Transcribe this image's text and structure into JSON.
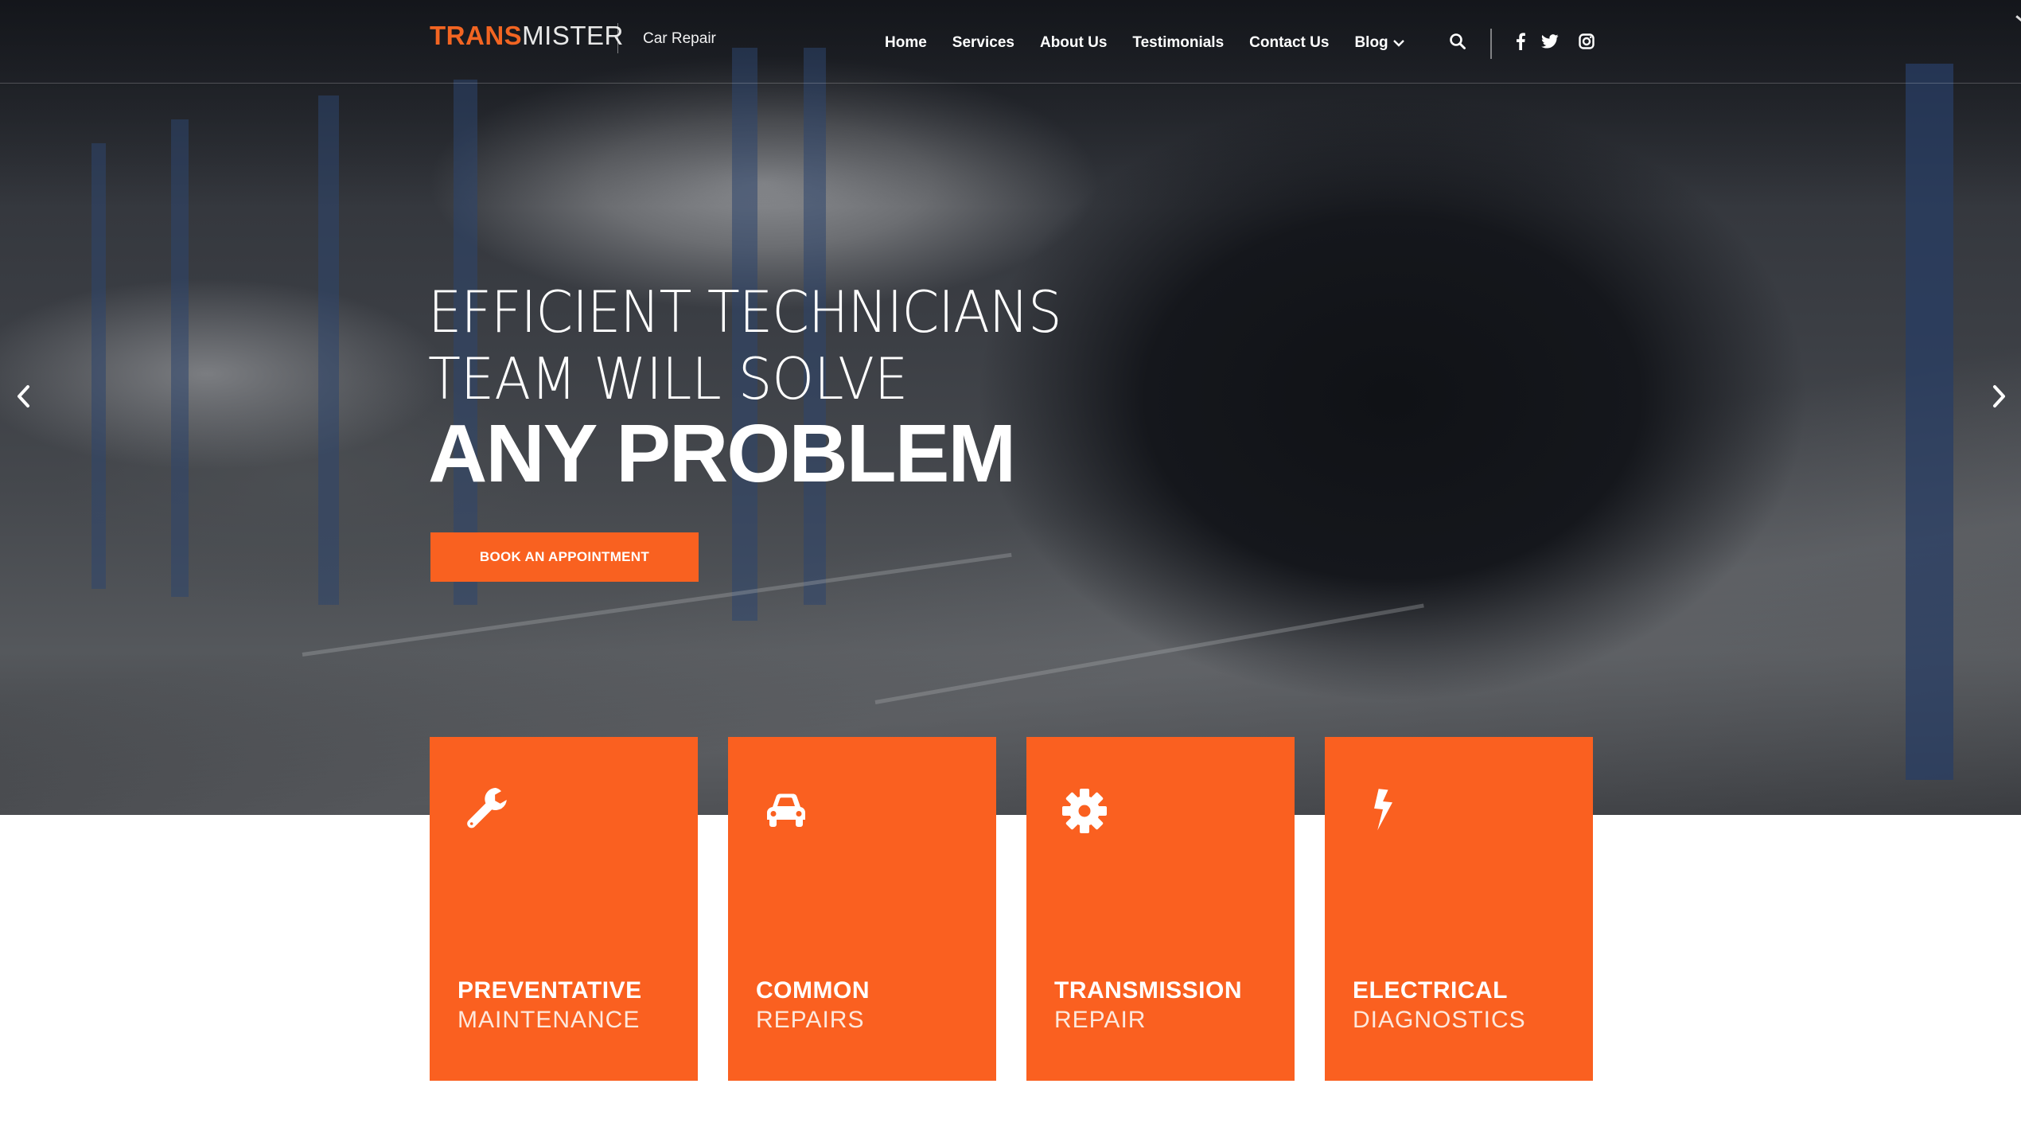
{
  "brand": {
    "logo_part1": "TRANS",
    "logo_part2": "MISTER",
    "tagline": "Car Repair",
    "accent_color": "#f96120"
  },
  "nav": {
    "items": [
      {
        "label": "Home"
      },
      {
        "label": "Services"
      },
      {
        "label": "About Us"
      },
      {
        "label": "Testimonials"
      },
      {
        "label": "Contact Us"
      },
      {
        "label": "Blog",
        "has_dropdown": true
      }
    ],
    "icons": [
      "search-icon",
      "facebook-icon",
      "twitter-icon",
      "instagram-icon"
    ]
  },
  "hero": {
    "line1": "EFFICIENT TECHNICIANS",
    "line2": "TEAM WILL SOLVE",
    "line3": "ANY PROBLEM",
    "cta_label": "BOOK AN APPOINTMENT",
    "prev_icon": "chevron-left-icon",
    "next_icon": "chevron-right-icon"
  },
  "services": [
    {
      "icon": "wrench-icon",
      "title": "PREVENTATIVE",
      "subtitle": "MAINTENANCE"
    },
    {
      "icon": "car-icon",
      "title": "COMMON",
      "subtitle": "REPAIRS"
    },
    {
      "icon": "gear-icon",
      "title": "TRANSMISSION",
      "subtitle": "REPAIR"
    },
    {
      "icon": "lightning-icon",
      "title": "ELECTRICAL",
      "subtitle": "DIAGNOSTICS"
    }
  ]
}
